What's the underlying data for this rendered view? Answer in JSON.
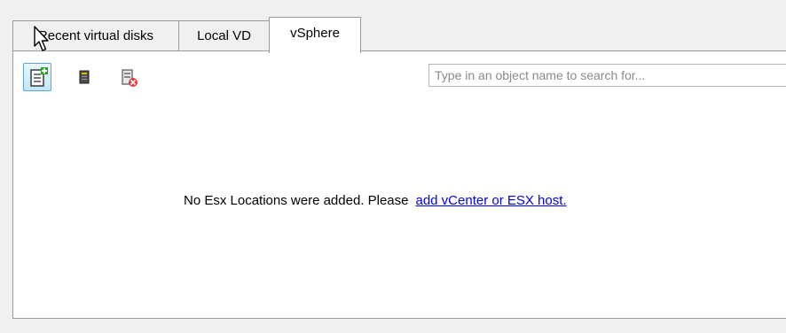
{
  "tabs": [
    {
      "label": "Recent virtual disks",
      "active": false
    },
    {
      "label": "Local VD",
      "active": false
    },
    {
      "label": "vSphere",
      "active": true
    }
  ],
  "toolbar": {
    "buttons": [
      {
        "icon": "add-location-icon",
        "selected": true
      },
      {
        "icon": "server-icon",
        "selected": false
      },
      {
        "icon": "remove-location-icon",
        "selected": false
      }
    ]
  },
  "search": {
    "placeholder": "Type in an object name to search for...",
    "value": ""
  },
  "empty_state": {
    "message": "No Esx Locations were added. Please",
    "link": "add vCenter or ESX host."
  }
}
